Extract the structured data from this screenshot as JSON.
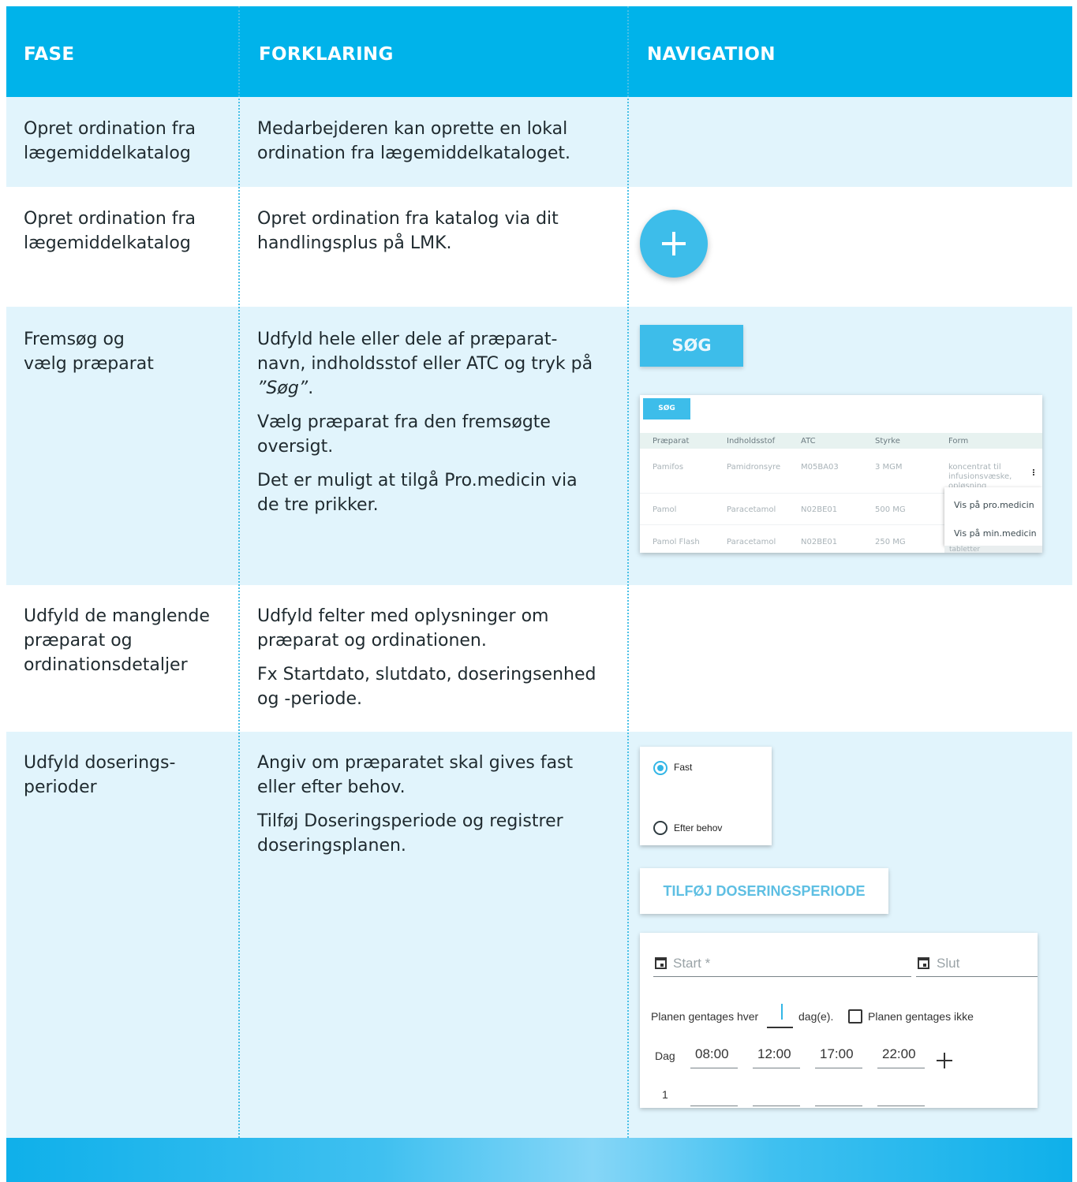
{
  "header": {
    "col1": "FASE",
    "col2": "FORKLARING",
    "col3": "NAVIGATION"
  },
  "rows": [
    {
      "fase": "Opret ordination fra lægemiddelkatalog",
      "forklaring": [
        "Medarbejderen kan oprette en lokal ordination fra lægemiddelkataloget."
      ]
    },
    {
      "fase": "Opret ordination fra lægemiddelkatalog",
      "forklaring": [
        "Opret ordination fra katalog via dit handlingsplus på LMK."
      ]
    },
    {
      "fase": "Fremsøg og vælg præparat",
      "forklaring_1_pre": "Udfyld hele eller dele af præparat-navn, indholdsstof eller ATC og tryk på ",
      "forklaring_1_em": "”Søg”",
      "forklaring_1_post": ".",
      "forklaring_2": "Vælg præparat fra den fremsøgte oversigt.",
      "forklaring_3": "Det er muligt at tilgå Pro.medicin via de tre prikker."
    },
    {
      "fase": "Udfyld de manglende præparat og ordinationsdetaljer",
      "forklaring_1": "Udfyld felter med oplysninger om præparat og ordinationen.",
      "forklaring_2": "Fx Startdato, slutdato, doseringsenhed og -periode."
    },
    {
      "fase": "Udfyld doserings-perioder",
      "forklaring_1": "Angiv om præparatet skal gives fast eller efter behov.",
      "forklaring_2": "Tilføj Doseringsperiode og registrer doseringsplanen."
    }
  ],
  "nav": {
    "sog_label": "SØG",
    "catalog": {
      "sog_label": "SØG",
      "columns": [
        "Præparat",
        "Indholdsstof",
        "ATC",
        "Styrke",
        "Form"
      ],
      "rows": [
        [
          "Pamifos",
          "Pamidronsyre",
          "M05BA03",
          "3 MGM",
          "koncentrat til infusionsvæske, opløsning"
        ],
        [
          "Pamol",
          "Paracetamol",
          "N02BE01",
          "500 MG",
          ""
        ],
        [
          "Pamol Flash",
          "Paracetamol",
          "N02BE01",
          "250 MG",
          "tabletter"
        ]
      ],
      "menu": [
        "Vis på pro.medicin",
        "Vis på min.medicin"
      ]
    },
    "radio": {
      "fast": "Fast",
      "efter_behov": "Efter behov",
      "selected": "Fast"
    },
    "add_period_label": "TILFØJ DOSERINGSPERIODE",
    "plan": {
      "start_placeholder": "Start *",
      "slut_placeholder": "Slut",
      "repeat_label": "Planen gentages hver",
      "repeat_unit": "dag(e).",
      "no_repeat_label": "Planen gentages ikke",
      "day_label": "Dag",
      "times": [
        "08:00",
        "12:00",
        "17:00",
        "22:00"
      ],
      "day_number": "1"
    }
  },
  "colors": {
    "header": "#00b3ea",
    "row_light": "#e1f4fc",
    "accent": "#3dbdea"
  }
}
